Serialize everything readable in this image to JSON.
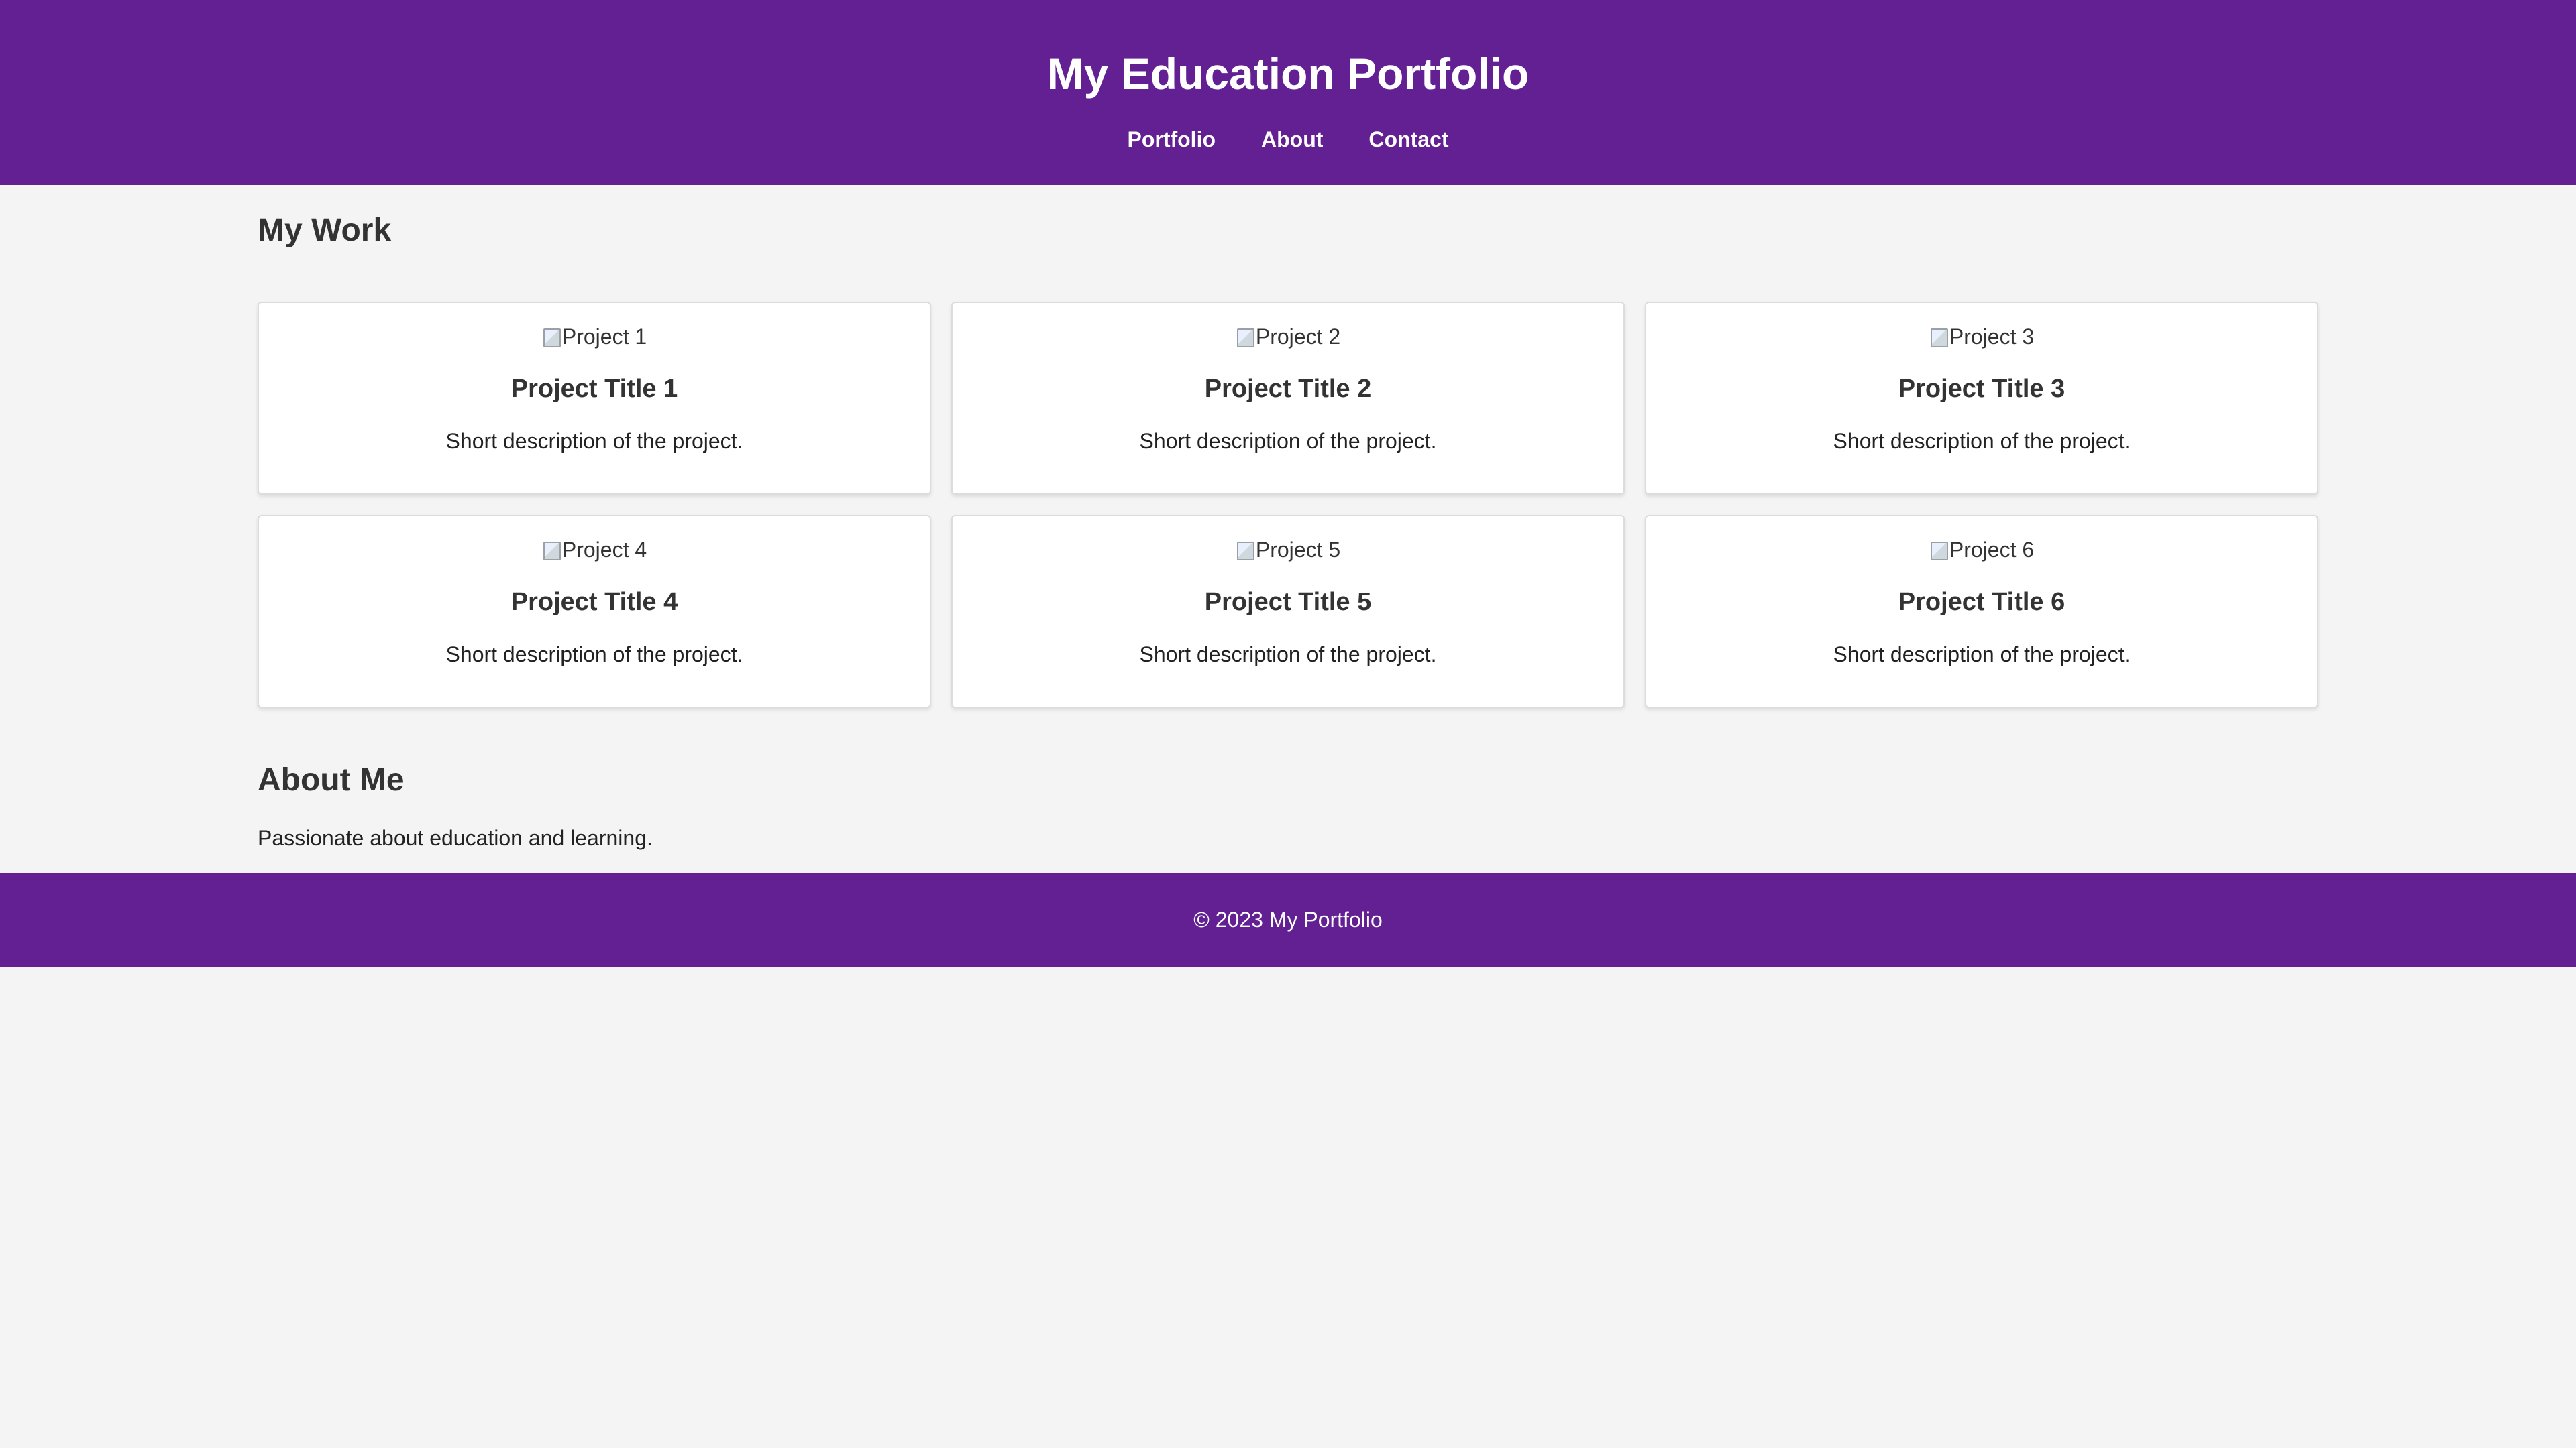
{
  "header": {
    "title": "My Education Portfolio",
    "nav": [
      {
        "label": "Portfolio"
      },
      {
        "label": "About"
      },
      {
        "label": "Contact"
      }
    ]
  },
  "work": {
    "heading": "My Work",
    "projects": [
      {
        "image_alt": "Project 1",
        "title": "Project Title 1",
        "description": "Short description of the project."
      },
      {
        "image_alt": "Project 2",
        "title": "Project Title 2",
        "description": "Short description of the project."
      },
      {
        "image_alt": "Project 3",
        "title": "Project Title 3",
        "description": "Short description of the project."
      },
      {
        "image_alt": "Project 4",
        "title": "Project Title 4",
        "description": "Short description of the project."
      },
      {
        "image_alt": "Project 5",
        "title": "Project Title 5",
        "description": "Short description of the project."
      },
      {
        "image_alt": "Project 6",
        "title": "Project Title 6",
        "description": "Short description of the project."
      }
    ]
  },
  "about": {
    "heading": "About Me",
    "text": "Passionate about education and learning."
  },
  "footer": {
    "text": "© 2023 My Portfolio"
  },
  "colors": {
    "brand_purple": "#632093",
    "page_background": "#f4f4f4",
    "card_background": "#ffffff"
  },
  "icons": {
    "project_image": "broken-image-icon"
  }
}
